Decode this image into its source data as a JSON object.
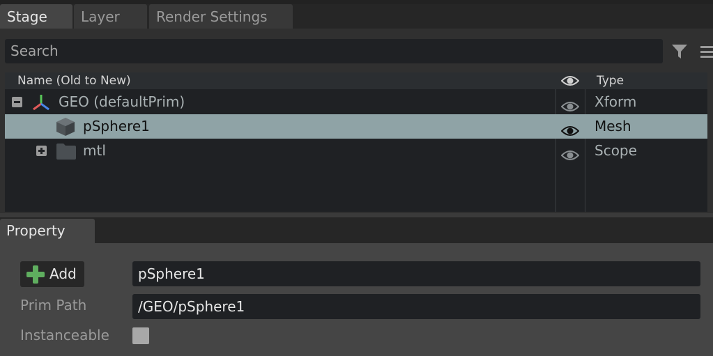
{
  "stage_panel": {
    "tabs": [
      "Stage",
      "Layer",
      "Render Settings"
    ],
    "search": {
      "placeholder": "Search"
    },
    "columns": {
      "name": "Name (Old to New)",
      "visibility": "eye-icon",
      "type": "Type"
    },
    "rows": [
      {
        "name": "GEO (defaultPrim)",
        "type": "Xform",
        "icon": "xform-axis-icon",
        "expander": "collapse",
        "selected": false
      },
      {
        "name": "pSphere1",
        "type": "Mesh",
        "icon": "mesh-cube-icon",
        "expander": "none",
        "selected": true
      },
      {
        "name": "mtl",
        "type": "Scope",
        "icon": "folder-icon",
        "expander": "expand",
        "selected": false
      }
    ]
  },
  "property_panel": {
    "tab": "Property",
    "add_label": "Add",
    "name_value": "pSphere1",
    "prim_path_label": "Prim Path",
    "prim_path_value": "/GEO/pSphere1",
    "instanceable_label": "Instanceable",
    "instanceable_checked": false
  },
  "colors": {
    "selection": "#8fa3a6",
    "add_plus": "#5fae5f",
    "axis_x": "#e05a5a",
    "axis_y": "#5ac85a",
    "axis_z": "#4a86e8"
  }
}
